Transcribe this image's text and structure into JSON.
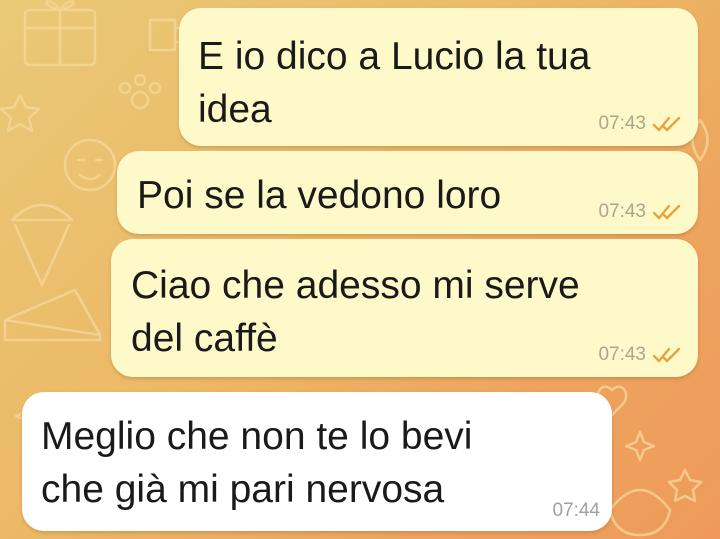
{
  "theme": {
    "outgoing_bubble": "#fdf9c8",
    "incoming_bubble": "#ffffff",
    "read_tick": "#e8a33a",
    "wallpaper": "orange-yellow gradient with doodle icons"
  },
  "messages": [
    {
      "direction": "outgoing",
      "lines": [
        "E io dico a Lucio la tua",
        "idea"
      ],
      "time": "07:43",
      "status": "read"
    },
    {
      "direction": "outgoing",
      "lines": [
        "Poi se la vedono loro"
      ],
      "time": "07:43",
      "status": "read"
    },
    {
      "direction": "outgoing",
      "lines": [
        "Ciao che adesso mi serve",
        "del caffè"
      ],
      "time": "07:43",
      "status": "read"
    },
    {
      "direction": "incoming",
      "lines": [
        "Meglio che non te lo bevi",
        "che già mi pari nervosa"
      ],
      "time": "07:44"
    }
  ]
}
